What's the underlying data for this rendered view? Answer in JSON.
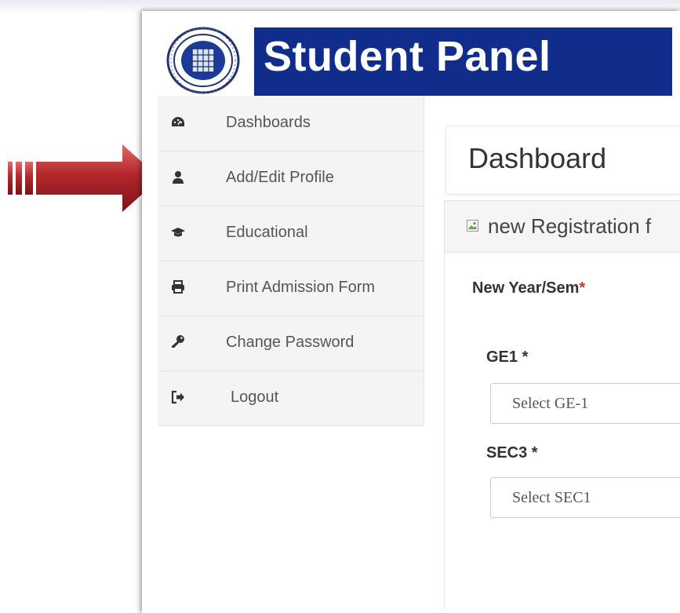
{
  "header": {
    "title": "Student Panel",
    "title_bg_color": "#112d8c"
  },
  "sidebar": {
    "items": [
      {
        "label": "Dashboards",
        "icon": "tachometer-icon"
      },
      {
        "label": "Add/Edit Profile",
        "icon": "user-icon"
      },
      {
        "label": "Educational",
        "icon": "graduation-cap-icon"
      },
      {
        "label": "Print Admission Form",
        "icon": "printer-icon"
      },
      {
        "label": "Change Password",
        "icon": "key-icon"
      },
      {
        "label": "Logout",
        "icon": "sign-out-icon"
      }
    ]
  },
  "main": {
    "page_title": "Dashboard",
    "panel_title": "new Registration f",
    "new_year_sem_label": "New Year/Sem",
    "required_mark": "*",
    "ge1_label": "GE1 *",
    "ge1_placeholder": "Select GE-1",
    "sec3_label": "SEC3 *",
    "sec3_placeholder": "Select SEC1"
  },
  "annotation": {
    "arrow_color": "#b3272c",
    "points_to": "Add/Edit Profile"
  }
}
